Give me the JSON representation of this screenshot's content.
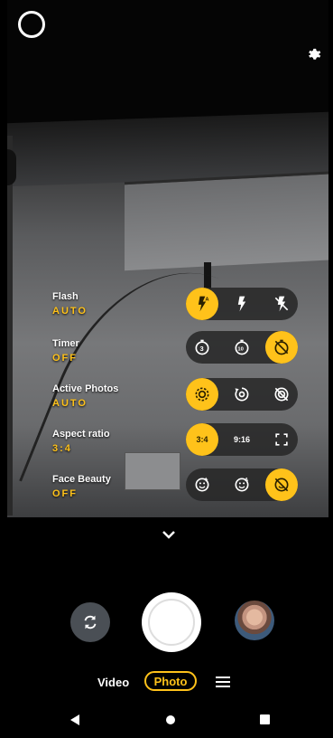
{
  "settings": [
    {
      "label": "Flash",
      "value": "AUTO",
      "options": [
        {
          "icon": "flash-auto-icon",
          "selected": true
        },
        {
          "icon": "flash-on-icon",
          "selected": false
        },
        {
          "icon": "flash-off-icon",
          "selected": false
        }
      ]
    },
    {
      "label": "Timer",
      "value": "OFF",
      "options": [
        {
          "icon": "timer-3s-icon",
          "selected": false
        },
        {
          "icon": "timer-10s-icon",
          "selected": false
        },
        {
          "icon": "timer-off-icon",
          "selected": true
        }
      ]
    },
    {
      "label": "Active Photos",
      "value": "AUTO",
      "options": [
        {
          "icon": "active-photos-auto-icon",
          "selected": true
        },
        {
          "icon": "active-photos-on-icon",
          "selected": false
        },
        {
          "icon": "active-photos-off-icon",
          "selected": false
        }
      ]
    },
    {
      "label": "Aspect ratio",
      "value": "3:4",
      "options": [
        {
          "text": "3:4",
          "selected": true
        },
        {
          "text": "9:16",
          "selected": false
        },
        {
          "icon": "fullscreen-icon",
          "selected": false
        }
      ]
    },
    {
      "label": "Face Beauty",
      "value": "OFF",
      "options": [
        {
          "icon": "face-beauty-manual-icon",
          "selected": false
        },
        {
          "icon": "face-beauty-auto-icon",
          "selected": false
        },
        {
          "icon": "face-beauty-off-icon",
          "selected": true
        }
      ]
    }
  ],
  "modes": {
    "video": "Video",
    "photo": "Photo"
  },
  "colors": {
    "accent": "#ffc21a",
    "pill_bg": "#282828",
    "switch_btn": "#4a4f55"
  }
}
